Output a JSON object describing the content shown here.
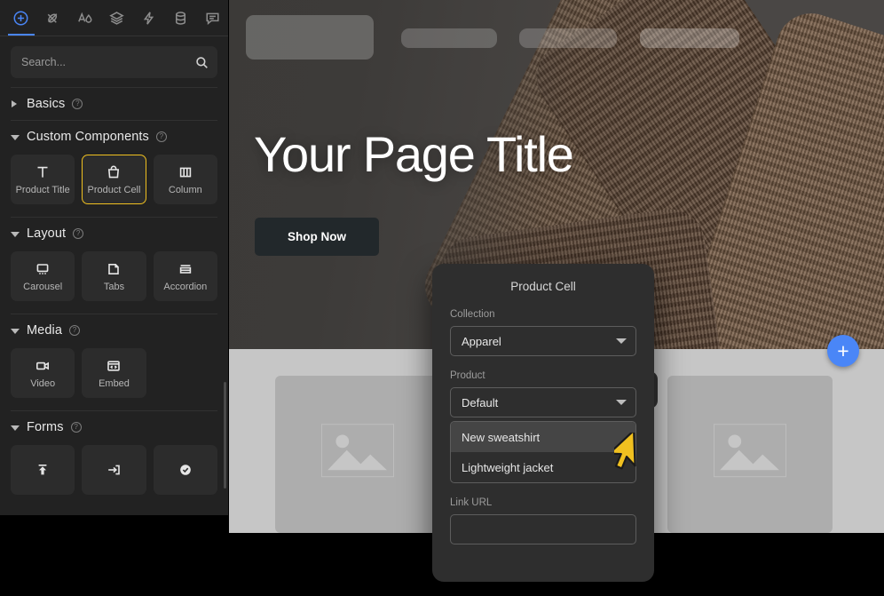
{
  "toolbar": {
    "icons": [
      {
        "name": "add-circle-icon",
        "label": "Insert",
        "active": true
      },
      {
        "name": "brush-icon",
        "label": "Style",
        "active": false
      },
      {
        "name": "typography-icon",
        "label": "Typography",
        "active": false
      },
      {
        "name": "layers-icon",
        "label": "Layers",
        "active": false
      },
      {
        "name": "bolt-icon",
        "label": "Interactions",
        "active": false
      },
      {
        "name": "database-icon",
        "label": "Data",
        "active": false
      },
      {
        "name": "comment-icon",
        "label": "Comments",
        "active": false
      }
    ]
  },
  "search": {
    "placeholder": "Search...",
    "value": "",
    "icon": "search-icon"
  },
  "sidebar": {
    "sections": [
      {
        "title": "Basics",
        "expanded": false,
        "help_icon": "help-circle-icon",
        "items": []
      },
      {
        "title": "Custom Components",
        "expanded": true,
        "help_icon": "help-circle-icon",
        "items": [
          {
            "label": "Product Title",
            "icon": "text-t-icon",
            "selected": false
          },
          {
            "label": "Product Cell",
            "icon": "shopping-bag-icon",
            "selected": true
          },
          {
            "label": "Column",
            "icon": "columns-icon",
            "selected": false
          }
        ]
      },
      {
        "title": "Layout",
        "expanded": true,
        "help_icon": "help-circle-icon",
        "items": [
          {
            "label": "Carousel",
            "icon": "carousel-icon",
            "selected": false
          },
          {
            "label": "Tabs",
            "icon": "tabs-icon",
            "selected": false
          },
          {
            "label": "Accordion",
            "icon": "accordion-icon",
            "selected": false
          }
        ]
      },
      {
        "title": "Media",
        "expanded": true,
        "help_icon": "help-circle-icon",
        "items": [
          {
            "label": "Video",
            "icon": "video-camera-icon",
            "selected": false
          },
          {
            "label": "Embed",
            "icon": "code-embed-icon",
            "selected": false
          }
        ]
      },
      {
        "title": "Forms",
        "expanded": true,
        "help_icon": "help-circle-icon",
        "items": [
          {
            "label": "",
            "icon": "file-upload-icon",
            "selected": false
          },
          {
            "label": "",
            "icon": "text-input-icon",
            "selected": false
          },
          {
            "label": "",
            "icon": "checkbox-check-icon",
            "selected": false
          }
        ]
      }
    ]
  },
  "canvas": {
    "nav_placeholders": [
      "logo-placeholder",
      "nav-item-1",
      "nav-item-2",
      "nav-item-3"
    ],
    "hero": {
      "title": "Your Page Title",
      "cta_label": "Shop Now"
    },
    "product_grid": {
      "cards": [
        "product-card-1",
        "product-card-2",
        "product-card-3"
      ],
      "image_placeholder_icon": "image-placeholder-icon",
      "badge_icon": "shopping-bag-icon"
    },
    "add_button": {
      "icon": "plus-icon",
      "label": "+",
      "color": "#4a86f7"
    }
  },
  "modal": {
    "title": "Product Cell",
    "fields": [
      {
        "label": "Collection",
        "type": "select",
        "value": "Apparel",
        "caret_icon": "chevron-down-icon"
      },
      {
        "label": "Product",
        "type": "select",
        "value": "Default",
        "caret_icon": "chevron-down-icon",
        "open": true,
        "options": [
          {
            "label": "New sweatshirt",
            "highlighted": true
          },
          {
            "label": "Lightweight jacket",
            "highlighted": false
          }
        ]
      },
      {
        "label": "Link URL",
        "type": "text",
        "value": "",
        "placeholder": ""
      }
    ]
  },
  "cursor": {
    "name": "mouse-pointer",
    "color": "#f0c020"
  },
  "colors": {
    "accent_blue": "#4a86f7",
    "selection_yellow": "#f0c020",
    "sidebar_bg": "#222222",
    "tile_bg": "#2c2c2c",
    "modal_bg": "#2e2e2e",
    "canvas_bg": "#4a4a4a",
    "product_area_bg": "#c6c6c6"
  }
}
